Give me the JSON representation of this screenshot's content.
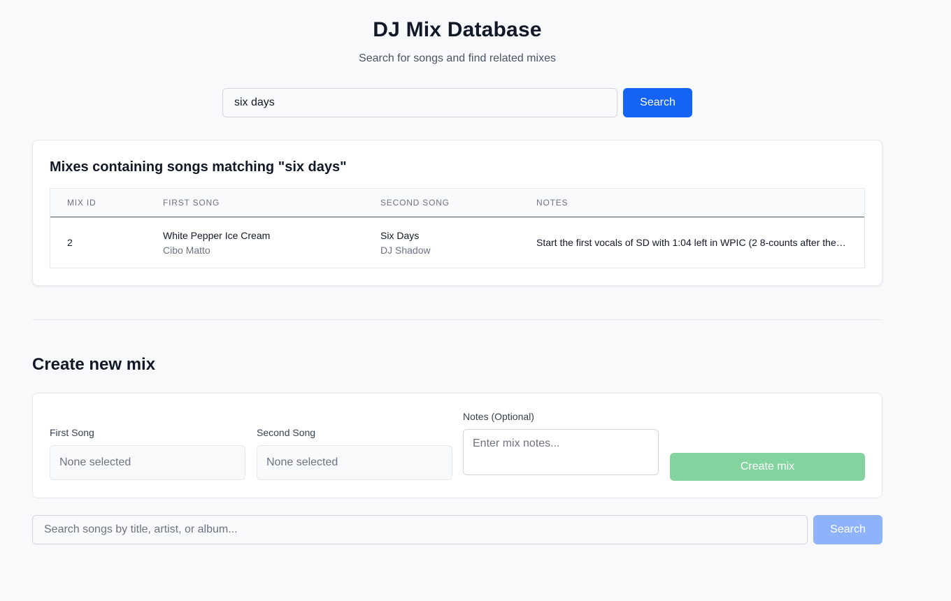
{
  "header": {
    "title": "DJ Mix Database",
    "subtitle": "Search for songs and find related mixes"
  },
  "top_search": {
    "value": "six days",
    "button_label": "Search",
    "accent_color": "#1463f5"
  },
  "results": {
    "heading": "Mixes containing songs matching \"six days\"",
    "columns": [
      "Mix ID",
      "First Song",
      "Second Song",
      "Notes"
    ],
    "rows": [
      {
        "mix_id": "2",
        "first_song": {
          "title": "White Pepper Ice Cream",
          "artist": "Cibo Matto"
        },
        "second_song": {
          "title": "Six Days",
          "artist": "DJ Shadow"
        },
        "notes": "Start the first vocals of SD with 1:04 left in WPIC (2 8-counts after the…"
      }
    ]
  },
  "create_mix": {
    "heading": "Create new mix",
    "first_song": {
      "label": "First Song",
      "value": "None selected"
    },
    "second_song": {
      "label": "Second Song",
      "value": "None selected"
    },
    "notes": {
      "label": "Notes (Optional)",
      "placeholder": "Enter mix notes..."
    },
    "button_label": "Create mix",
    "button_color": "#82d39d"
  },
  "song_search": {
    "placeholder": "Search songs by title, artist, or album...",
    "button_label": "Search"
  }
}
